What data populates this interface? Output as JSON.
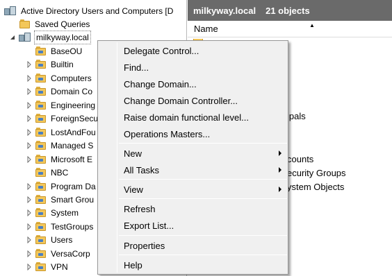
{
  "tree": {
    "root_label": "Active Directory Users and Computers [D",
    "saved_queries": "Saved Queries",
    "domain": "milkyway.local",
    "children": [
      {
        "label": "BaseOU",
        "expandable": false
      },
      {
        "label": "Builtin",
        "expandable": true
      },
      {
        "label": "Computers",
        "expandable": true
      },
      {
        "label": "Domain Co",
        "expandable": true
      },
      {
        "label": "Engineering",
        "expandable": true
      },
      {
        "label": "ForeignSecu",
        "expandable": true
      },
      {
        "label": "LostAndFou",
        "expandable": true
      },
      {
        "label": "Managed S",
        "expandable": true
      },
      {
        "label": "Microsoft E",
        "expandable": true
      },
      {
        "label": "NBC",
        "expandable": false
      },
      {
        "label": "Program Da",
        "expandable": true
      },
      {
        "label": "Smart Grou",
        "expandable": true
      },
      {
        "label": "System",
        "expandable": true
      },
      {
        "label": "TestGroups",
        "expandable": true
      },
      {
        "label": "Users",
        "expandable": true
      },
      {
        "label": "VersaCorp",
        "expandable": true
      },
      {
        "label": "VPN",
        "expandable": true
      }
    ]
  },
  "details": {
    "title": "milkyway.local",
    "count": "21 objects",
    "column_name": "Name",
    "visible_items": [
      "ipals",
      "counts",
      "ecurity Groups",
      "ystem Objects"
    ]
  },
  "context_menu": {
    "items": [
      {
        "label": "Delegate Control...",
        "submenu": false
      },
      {
        "label": "Find...",
        "submenu": false
      },
      {
        "label": "Change Domain...",
        "submenu": false
      },
      {
        "label": "Change Domain Controller...",
        "submenu": false
      },
      {
        "label": "Raise domain functional level...",
        "submenu": false
      },
      {
        "label": "Operations Masters...",
        "submenu": false
      },
      {
        "label": "New",
        "submenu": true
      },
      {
        "label": "All Tasks",
        "submenu": true
      },
      {
        "label": "View",
        "submenu": true
      },
      {
        "label": "Refresh",
        "submenu": false
      },
      {
        "label": "Export List...",
        "submenu": false
      },
      {
        "label": "Properties",
        "submenu": false
      },
      {
        "label": "Help",
        "submenu": false
      }
    ]
  },
  "colors": {
    "header_bg": "#6a6a6a",
    "menu_bg": "#f0f0f0",
    "folder": "#f3c75a"
  }
}
